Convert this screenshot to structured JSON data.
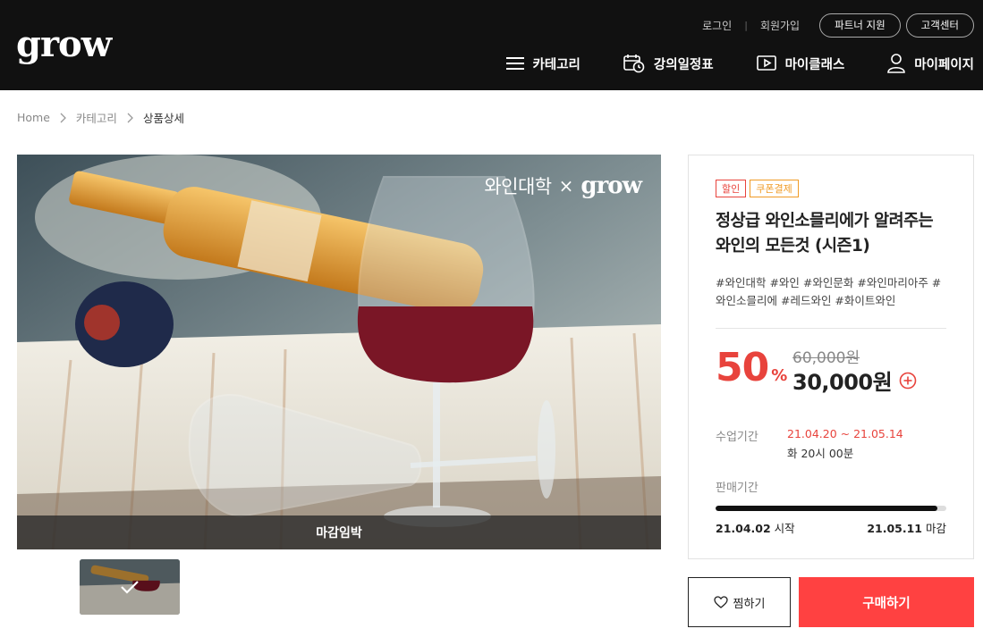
{
  "header": {
    "logo": "grow",
    "top_links": {
      "login": "로그인",
      "signup": "회원가입"
    },
    "pills": {
      "partner": "파트너 지원",
      "support": "고객센터"
    },
    "nav": [
      {
        "label": "카테고리",
        "icon": "menu-icon"
      },
      {
        "label": "강의일정표",
        "icon": "calendar-clock-icon"
      },
      {
        "label": "마이클래스",
        "icon": "play-screen-icon"
      },
      {
        "label": "마이페이지",
        "icon": "user-icon"
      }
    ]
  },
  "breadcrumb": {
    "home": "Home",
    "category": "카테고리",
    "current": "상품상세"
  },
  "hero": {
    "brand_left": "와인대학",
    "brand_x": "×",
    "brand_right": "grow",
    "closing_label": "마감임박"
  },
  "product": {
    "badges": {
      "sale": "할인",
      "coupon": "쿠폰결제"
    },
    "title": "정상급 와인소믈리에가 알려주는 와인의 모든것 (시즌1)",
    "tags": "#와인대학 #와인 #와인문화 #와인마리아주 #와인소믈리에 #레드와인 #화이트와인",
    "discount_value": "50",
    "discount_unit": "%",
    "original_price": "60,000원",
    "price": "30,000원",
    "class_period_label": "수업기간",
    "class_period_dates": "21.04.20 ~ 21.05.14",
    "class_period_time": "화 20시 00분",
    "sale_period_label": "판매기간",
    "sale_progress": 0.96,
    "sale_start_date": "21.04.02",
    "sale_start_suffix": "시작",
    "sale_end_date": "21.05.11",
    "sale_end_suffix": "마감"
  },
  "buttons": {
    "wish": "찜하기",
    "buy": "구매하기"
  },
  "colors": {
    "accent": "#ff4141",
    "sale_red": "#e8433c",
    "coupon_orange": "#f09b26",
    "header_bg": "#111111"
  }
}
